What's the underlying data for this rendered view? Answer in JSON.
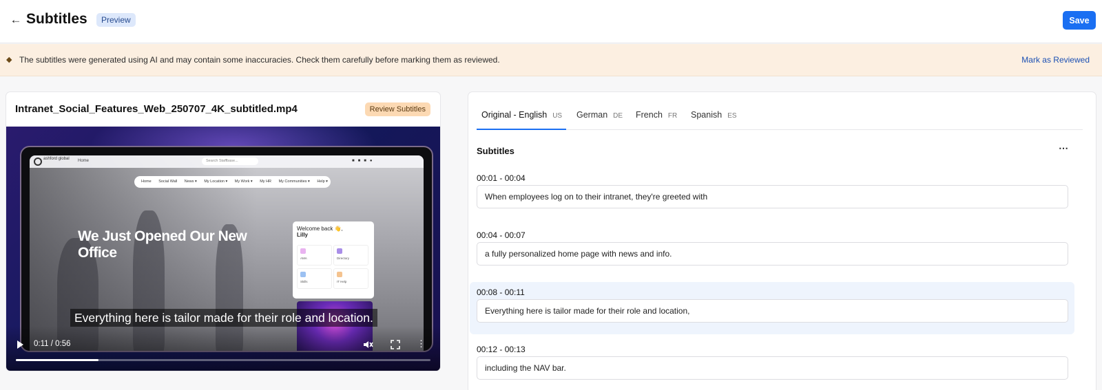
{
  "header": {
    "back_icon": "arrow-left-icon",
    "title": "Subtitles",
    "badge": "Preview",
    "save_label": "Save"
  },
  "banner": {
    "icon": "diamond-warning-icon",
    "message": "The subtitles were generated using AI and may contain some inaccuracies. Check them carefully before marking them as reviewed.",
    "action_label": "Mark as Reviewed"
  },
  "video_panel": {
    "file_name": "Intranet_Social_Features_Web_250707_4K_subtitled.mp4",
    "status_badge": "Review Subtitles",
    "frame": {
      "logo_text": "ashford global",
      "home_label": "Home",
      "search_placeholder": "Search Staffbase...",
      "nav_items": [
        "Home",
        "Social Wall",
        "News ▾",
        "My Location ▾",
        "My Work ▾",
        "My HR",
        "My Communities ▾",
        "Help ▾"
      ],
      "headline": "We Just Opened Our New Office",
      "welcome_line": "Welcome back 👋,",
      "welcome_name": "Lilly",
      "tiles": [
        "AMA",
        "Directory",
        "Skills",
        "IT Help"
      ]
    },
    "caption": "Everything here is tailor made for their role and location.",
    "player": {
      "time_display": "0:11 / 0:56",
      "progress_fraction": 0.2,
      "play_icon": "play-icon",
      "mute_icon": "volume-muted-icon",
      "fullscreen_icon": "fullscreen-icon",
      "more_icon": "more-vertical-icon"
    }
  },
  "subtitles_panel": {
    "tabs": [
      {
        "label": "Original - English",
        "code": "US",
        "active": true
      },
      {
        "label": "German",
        "code": "DE",
        "active": false
      },
      {
        "label": "French",
        "code": "FR",
        "active": false
      },
      {
        "label": "Spanish",
        "code": "ES",
        "active": false
      }
    ],
    "section_title": "Subtitles",
    "menu_icon": "more-horizontal-icon",
    "segments": [
      {
        "time": "00:01 - 00:04",
        "text": "When employees log on to their intranet, they're greeted with",
        "active": false
      },
      {
        "time": "00:04 - 00:07",
        "text": "a fully personalized home page with news and info.",
        "active": false
      },
      {
        "time": "00:08 - 00:11",
        "text": "Everything here is tailor made for their role and location,",
        "active": true
      },
      {
        "time": "00:12 - 00:13",
        "text": "including the NAV bar.",
        "active": false
      }
    ]
  },
  "colors": {
    "accent": "#1a6ff2",
    "banner_bg": "#fcefe1",
    "preview_badge_bg": "#dde8fb",
    "review_badge_bg": "#fcd9b3",
    "active_segment_bg": "#eef4fd"
  }
}
